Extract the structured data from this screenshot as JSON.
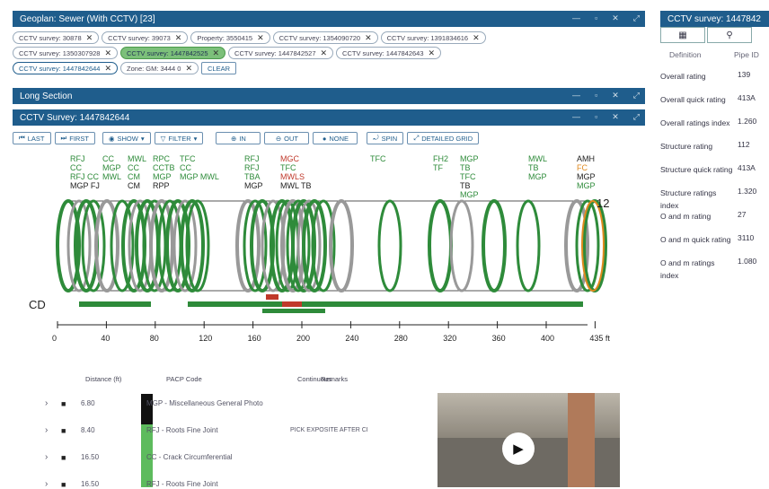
{
  "top_bar": {
    "title": "Geoplan: Sewer (With CCTV) [23]"
  },
  "filters": {
    "row1": [
      "CCTV survey: 30878",
      "CCTV survey: 39073",
      "Property: 3550415",
      "CCTV survey: 1354090720",
      "CCTV survey: 1391834616"
    ],
    "row2": [
      "CCTV survey: 1350307928",
      "CCTV survey: 1447842525",
      "CCTV survey: 1447842527",
      "CCTV survey: 1447842643"
    ],
    "row3_selected": "CCTV survey: 1447842644",
    "row3_zone": "Zone: GM: 3444 0",
    "clear": "CLEAR"
  },
  "long_section": {
    "title": "Long Section"
  },
  "cctv_bar": {
    "title": "CCTV Survey: 1447842644"
  },
  "toolbar": {
    "last": "LAST",
    "first": "FIRST",
    "show": "SHOW",
    "filter": "FILTER",
    "in": "IN",
    "out": "OUT",
    "none": "NONE",
    "spin": "SPIN",
    "grid": "DETAILED GRID"
  },
  "diagram": {
    "row_label": "CD",
    "end_label": "12",
    "axis": [
      "0",
      "40",
      "80",
      "120",
      "160",
      "200",
      "240",
      "280",
      "320",
      "360",
      "400",
      "435 ft"
    ],
    "codes": {
      "g1": [
        "RFJ",
        "CC",
        "RFJ CC",
        "MGP FJ"
      ],
      "g2": [
        "CC",
        "MGP",
        "MWL"
      ],
      "g3": [
        "MWL",
        "CC",
        "CM",
        "CM"
      ],
      "g4": [
        "RPC",
        "CCTB",
        "MGP",
        "RPP"
      ],
      "g5": [
        "TFC",
        "CC",
        "MGP MWL"
      ],
      "g6": [
        "RFJ",
        "RFJ",
        "TBA",
        "MGP"
      ],
      "g7": [
        "MGC",
        "TFC",
        "MWLS",
        "MWL TB"
      ],
      "g8": [
        "TFC"
      ],
      "g9": [
        "FH2",
        "TF"
      ],
      "g10": [
        "MGP",
        "TB",
        "TFC",
        "TB",
        "MGP"
      ],
      "g11": [
        "MWL",
        "TB",
        "MGP"
      ],
      "g12": [
        "AMH",
        "FC",
        "MGP",
        "MGP"
      ]
    }
  },
  "right_panel": {
    "title": "CCTV survey: 1447842",
    "col1": "Definition",
    "col2": "Pipe ID",
    "rows": [
      {
        "name": "Overall rating",
        "value": "139"
      },
      {
        "name": "Overall quick rating",
        "value": "413A"
      },
      {
        "name": "Overall ratings index",
        "value": "1.260"
      },
      {
        "name": "Structure rating",
        "value": "112"
      },
      {
        "name": "Structure quick rating",
        "value": "413A"
      },
      {
        "name": "Structure ratings index",
        "value": "1.320"
      },
      {
        "name": "O and m rating",
        "value": "27"
      },
      {
        "name": "O and m quick rating",
        "value": "3110"
      },
      {
        "name": "O and m ratings index",
        "value": "1.080"
      }
    ]
  },
  "table": {
    "headers": [
      "Distance (ft)",
      "PACP Code",
      "Continuous",
      "Remarks"
    ],
    "rows": [
      {
        "distance": "6.80",
        "code": "MGP - Miscellaneous General Photo",
        "remarks": ""
      },
      {
        "distance": "8.40",
        "code": "RFJ - Roots Fine Joint",
        "remarks": "PICK EXPOSITE AFTER CI"
      },
      {
        "distance": "16.50",
        "code": "CC - Crack Circumferential",
        "remarks": ""
      },
      {
        "distance": "16.50",
        "code": "RFJ - Roots Fine Joint",
        "remarks": ""
      }
    ]
  }
}
